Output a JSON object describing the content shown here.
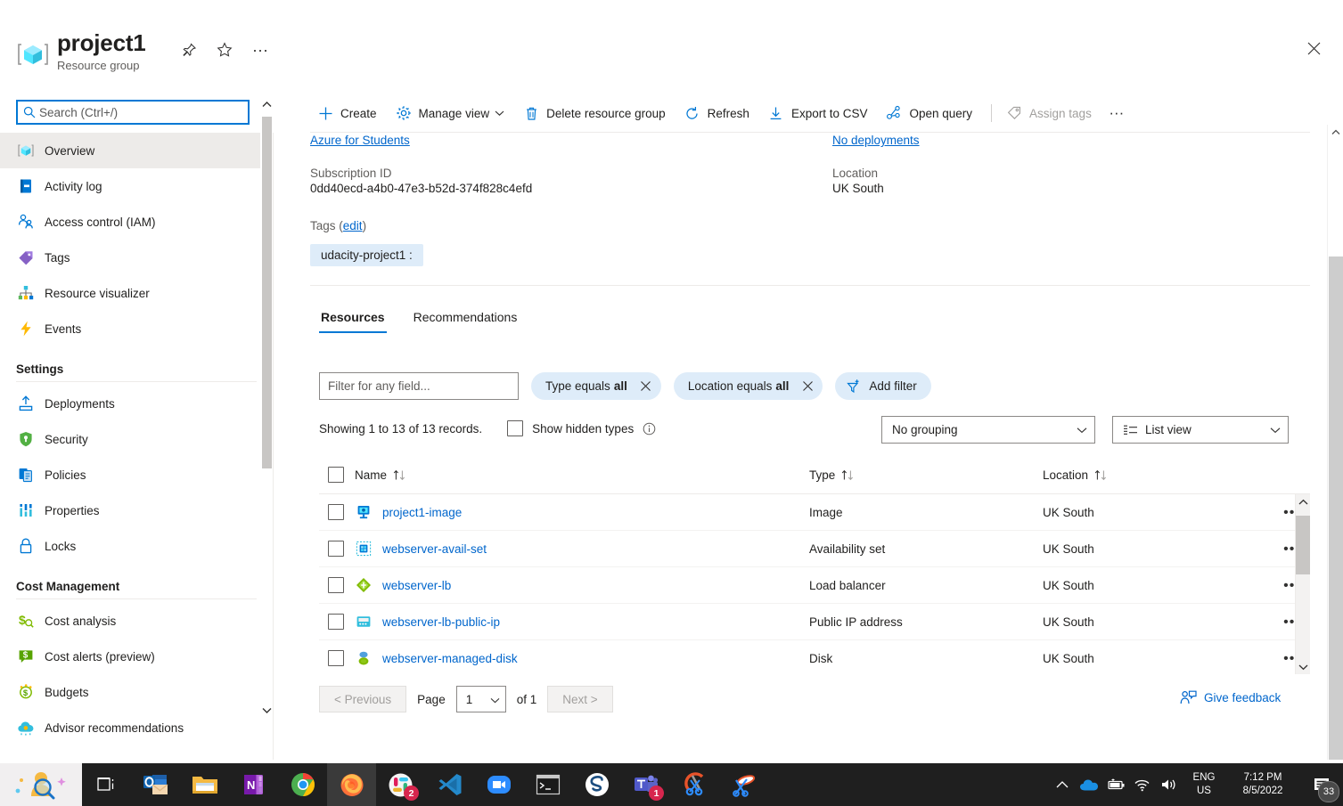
{
  "blade": {
    "title": "project1",
    "subtitle": "Resource group",
    "icons": {
      "pin": "pin-icon",
      "favorite": "star-icon",
      "more": "ellipsis-icon",
      "close": "close-icon"
    }
  },
  "sidebar": {
    "search": {
      "placeholder": "Search (Ctrl+/)",
      "value": ""
    },
    "collapse_label": "«",
    "items": [
      {
        "label": "Overview",
        "icon": "resource-group-icon",
        "selected": true
      },
      {
        "label": "Activity log",
        "icon": "activity-log-icon",
        "selected": false
      },
      {
        "label": "Access control (IAM)",
        "icon": "access-control-icon",
        "selected": false
      },
      {
        "label": "Tags",
        "icon": "tags-icon",
        "selected": false
      },
      {
        "label": "Resource visualizer",
        "icon": "resource-visualizer-icon",
        "selected": false
      },
      {
        "label": "Events",
        "icon": "events-icon",
        "selected": false
      }
    ],
    "groups": [
      {
        "title": "Settings",
        "items": [
          {
            "label": "Deployments",
            "icon": "deployments-icon"
          },
          {
            "label": "Security",
            "icon": "security-shield-icon"
          },
          {
            "label": "Policies",
            "icon": "policies-icon"
          },
          {
            "label": "Properties",
            "icon": "properties-icon"
          },
          {
            "label": "Locks",
            "icon": "lock-icon"
          }
        ]
      },
      {
        "title": "Cost Management",
        "items": [
          {
            "label": "Cost analysis",
            "icon": "cost-analysis-icon"
          },
          {
            "label": "Cost alerts (preview)",
            "icon": "cost-alerts-icon"
          },
          {
            "label": "Budgets",
            "icon": "budgets-icon"
          },
          {
            "label": "Advisor recommendations",
            "icon": "advisor-icon"
          }
        ]
      }
    ]
  },
  "toolbar": {
    "create": "Create",
    "manage_view": "Manage view",
    "delete_resource_group": "Delete resource group",
    "refresh": "Refresh",
    "export_csv": "Export to CSV",
    "open_query": "Open query",
    "assign_tags": "Assign tags",
    "more": "…"
  },
  "essentials": {
    "subscription_link": "Azure for Students",
    "subscription_id_label": "Subscription ID",
    "subscription_id_value": "0dd40ecd-a4b0-47e3-b52d-374f828c4efd",
    "deployments_link": "No deployments",
    "location_label": "Location",
    "location_value": "UK South",
    "tags_label": "Tags",
    "tags_edit": "edit",
    "tag_chip": "udacity-project1 :"
  },
  "tabs": [
    {
      "label": "Resources",
      "active": true
    },
    {
      "label": "Recommendations",
      "active": false
    }
  ],
  "filters": {
    "search_placeholder": "Filter for any field...",
    "search_value": "",
    "pills": [
      {
        "prefix": "Type equals",
        "value": "all"
      },
      {
        "prefix": "Location equals",
        "value": "all"
      }
    ],
    "add_filter": "Add filter"
  },
  "records": {
    "showing_text": "Showing 1 to 13 of 13 records.",
    "show_hidden_types": "Show hidden types",
    "grouping": "No grouping",
    "view": "List view"
  },
  "table": {
    "columns": [
      {
        "label": "Name"
      },
      {
        "label": "Type"
      },
      {
        "label": "Location"
      }
    ],
    "rows": [
      {
        "name": "project1-image",
        "type": "Image",
        "location": "UK South",
        "icon": "image-resource-icon"
      },
      {
        "name": "webserver-avail-set",
        "type": "Availability set",
        "location": "UK South",
        "icon": "availability-set-icon"
      },
      {
        "name": "webserver-lb",
        "type": "Load balancer",
        "location": "UK South",
        "icon": "load-balancer-icon"
      },
      {
        "name": "webserver-lb-public-ip",
        "type": "Public IP address",
        "location": "UK South",
        "icon": "public-ip-icon"
      },
      {
        "name": "webserver-managed-disk",
        "type": "Disk",
        "location": "UK South",
        "icon": "disk-icon"
      }
    ]
  },
  "pager": {
    "previous": "< Previous",
    "page_label": "Page",
    "page_value": "1",
    "of_label": "of 1",
    "next": "Next >",
    "feedback": "Give feedback"
  },
  "taskbar": {
    "apps": [
      {
        "name": "task-view-icon",
        "badge": ""
      },
      {
        "name": "outlook-icon",
        "badge": ""
      },
      {
        "name": "file-explorer-icon",
        "badge": ""
      },
      {
        "name": "onenote-icon",
        "badge": ""
      },
      {
        "name": "chrome-icon",
        "badge": ""
      },
      {
        "name": "firefox-icon",
        "badge": ""
      },
      {
        "name": "slack-icon",
        "badge": "2"
      },
      {
        "name": "vscode-icon",
        "badge": ""
      },
      {
        "name": "zoom-icon",
        "badge": ""
      },
      {
        "name": "terminal-icon",
        "badge": ""
      },
      {
        "name": "sublime-icon",
        "badge": ""
      },
      {
        "name": "teams-icon",
        "badge": "1"
      },
      {
        "name": "snip-sketch-icon",
        "badge": ""
      },
      {
        "name": "snipping-tool-icon",
        "badge": ""
      }
    ],
    "language_line1": "ENG",
    "language_line2": "US",
    "time": "7:12 PM",
    "date": "8/5/2022",
    "notification_count": "33"
  },
  "colors": {
    "accent": "#0078d4",
    "link": "#0066cc",
    "pill_bg": "#deecf9",
    "selected_nav": "#edebe9"
  }
}
